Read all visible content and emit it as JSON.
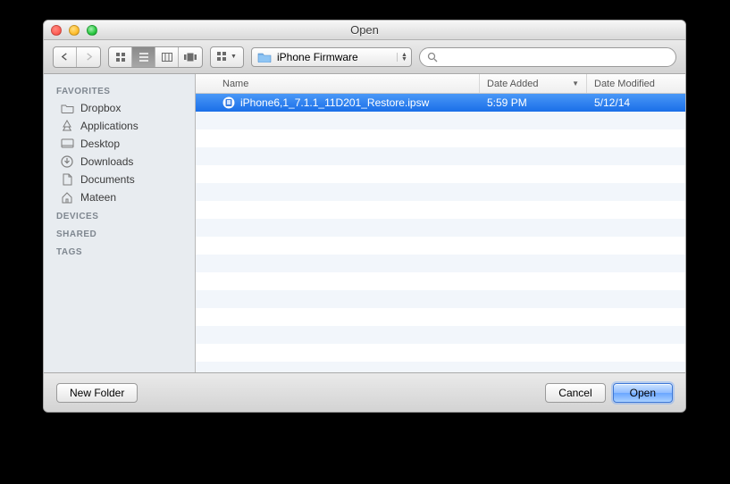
{
  "window": {
    "title": "Open"
  },
  "toolbar": {
    "path_dropdown": {
      "label": "iPhone Firmware"
    },
    "search": {
      "placeholder": ""
    }
  },
  "sidebar": {
    "sections": {
      "favorites_label": "FAVORITES",
      "devices_label": "DEVICES",
      "shared_label": "SHARED",
      "tags_label": "TAGS"
    },
    "favorites": [
      {
        "label": "Dropbox",
        "icon": "folder"
      },
      {
        "label": "Applications",
        "icon": "apps"
      },
      {
        "label": "Desktop",
        "icon": "desktop"
      },
      {
        "label": "Downloads",
        "icon": "downloads"
      },
      {
        "label": "Documents",
        "icon": "documents"
      },
      {
        "label": "Mateen",
        "icon": "home"
      }
    ]
  },
  "columns": {
    "name": "Name",
    "date_added": "Date Added",
    "date_modified": "Date Modified"
  },
  "files": [
    {
      "name": "iPhone6,1_7.1.1_11D201_Restore.ipsw",
      "date_added": "5:59 PM",
      "date_modified": "5/12/14",
      "selected": true
    }
  ],
  "footer": {
    "new_folder": "New Folder",
    "cancel": "Cancel",
    "open": "Open"
  }
}
